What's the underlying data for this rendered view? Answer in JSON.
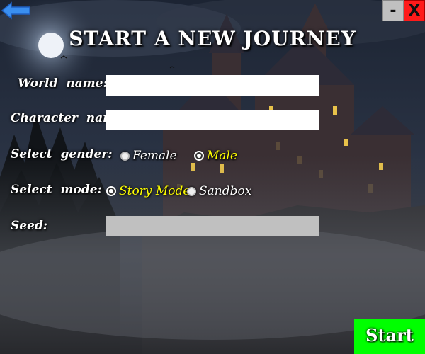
{
  "header": {
    "back_icon": "arrow-left-icon",
    "minimize_label": "-",
    "close_label": "X",
    "title": "START A NEW JOURNEY"
  },
  "form": {
    "world_name_label": "World name:",
    "world_name_value": "",
    "character_name_label": "Character name:",
    "character_name_value": "",
    "gender_label": "Select gender:",
    "gender_options": [
      "Female",
      "Male"
    ],
    "gender_selected": "Male",
    "mode_label": "Select mode:",
    "mode_options": [
      "Story Mode",
      "Sandbox"
    ],
    "mode_selected": "Story Mode",
    "seed_label": "Seed:",
    "seed_value": ""
  },
  "start_label": "Start",
  "colors": {
    "option_white": "#ffffff",
    "option_selected": "#ffff00",
    "start_bg": "#00ff00",
    "close_bg": "#ff1a1a",
    "minimize_bg": "#c0c0c0",
    "back_arrow": "#3a8ff0"
  }
}
